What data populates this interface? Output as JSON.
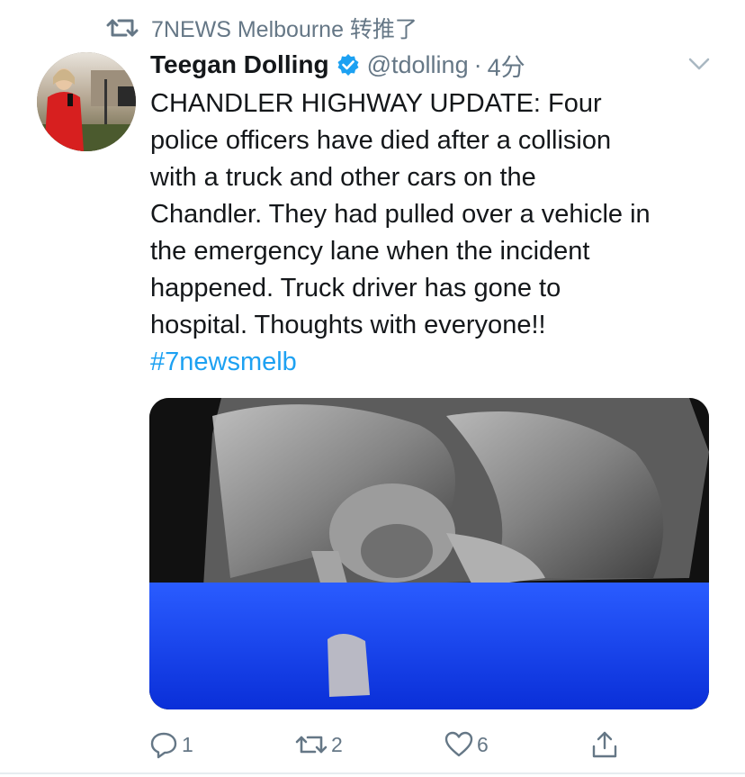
{
  "retweet_context": {
    "text": "7NEWS Melbourne 转推了"
  },
  "author": {
    "display_name": "Teegan Dolling",
    "handle": "@tdolling",
    "separator": "·",
    "time": "4分",
    "verified": true
  },
  "tweet": {
    "lines": [
      "CHANDLER HIGHWAY UPDATE: Four",
      "police officers have died after a collision",
      "with a truck and other cars on the",
      "Chandler. They had pulled over a vehicle in",
      "the emergency lane when the incident",
      "happened. Truck driver has gone to",
      "hospital. Thoughts with everyone!!"
    ],
    "hashtag": "#7newsmelb"
  },
  "media": {
    "type": "photo",
    "description_icon": "image-icon"
  },
  "actions": {
    "reply": {
      "icon": "reply-icon",
      "count": "1"
    },
    "retweet": {
      "icon": "retweet-icon",
      "count": "2"
    },
    "like": {
      "icon": "heart-icon",
      "count": "6"
    },
    "share": {
      "icon": "share-icon"
    }
  },
  "colors": {
    "link": "#1da1f2",
    "muted": "#657786",
    "text": "#14171a",
    "verified": "#1da1f2"
  }
}
